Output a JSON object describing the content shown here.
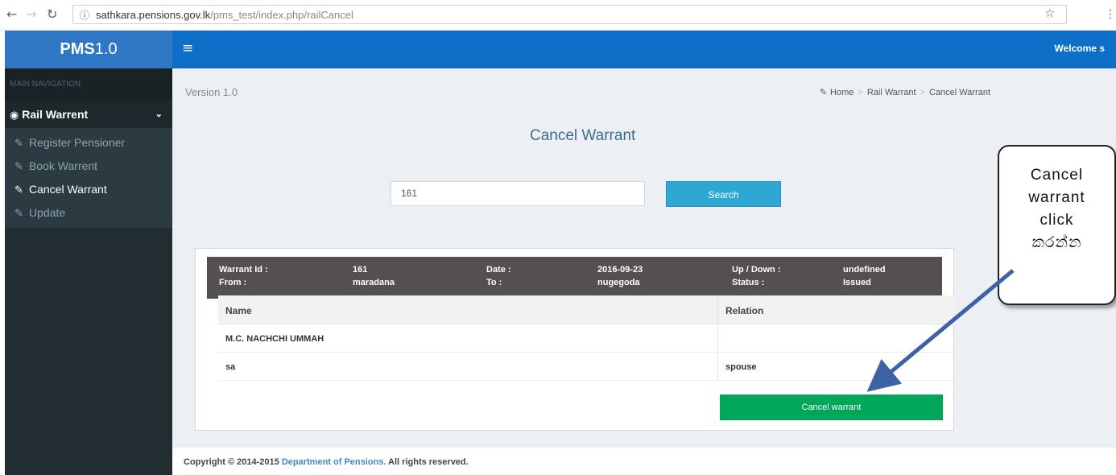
{
  "browser": {
    "url_domain": "sathkara.pensions.gov.lk",
    "url_path": "/pms_test/index.php/railCancel",
    "icons": {
      "back": "back-arrow-icon",
      "forward": "forward-arrow-icon",
      "reload": "reload-icon",
      "info": "info-icon",
      "star": "star-icon",
      "menu": "kebab-menu-icon"
    }
  },
  "sidebar": {
    "logo_bold": "PMS",
    "logo_rest": "1.0",
    "nav_header": "MAIN NAVIGATION",
    "section_label": "Rail Warrent",
    "items": [
      {
        "label": "Register Pensioner",
        "active": false
      },
      {
        "label": "Book Warrent",
        "active": false
      },
      {
        "label": "Cancel Warrant",
        "active": true
      },
      {
        "label": "Update",
        "active": false
      }
    ]
  },
  "header": {
    "welcome": "Welcome s"
  },
  "content": {
    "version": "Version 1.0",
    "breadcrumb": [
      "Home",
      "Rail Warrant",
      "Cancel Warrant"
    ],
    "title": "Cancel Warrant",
    "search": {
      "value": "161",
      "button_label": "Search"
    },
    "warrant": {
      "id_label": "Warrant Id :",
      "id_value": "161",
      "date_label": "Date :",
      "date_value": "2016-09-23",
      "updown_label": "Up / Down :",
      "updown_value": "undefined",
      "from_label": "From :",
      "from_value": "maradana",
      "to_label": "To :",
      "to_value": "nugegoda",
      "status_label": "Status :",
      "status_value": "Issued"
    },
    "table": {
      "headers": [
        "Name",
        "Relation"
      ],
      "rows": [
        {
          "name": "M.C. NACHCHI UMMAH",
          "relation": ""
        },
        {
          "name": "sa",
          "relation": "spouse"
        }
      ]
    },
    "cancel_button": "Cancel warrant"
  },
  "footer": {
    "prefix": "Copyright © 2014-2015 ",
    "link": "Department of Pensions.",
    "suffix": " All rights reserved."
  },
  "callout": {
    "lines": [
      "Cancel",
      "warrant",
      "click",
      "කරන්න"
    ]
  },
  "colors": {
    "header_blue": "#0e6fc8",
    "sidebar_dark": "#222d32",
    "search_blue": "#2fa7d5",
    "cancel_green": "#00a65a",
    "info_bar": "#545050"
  }
}
